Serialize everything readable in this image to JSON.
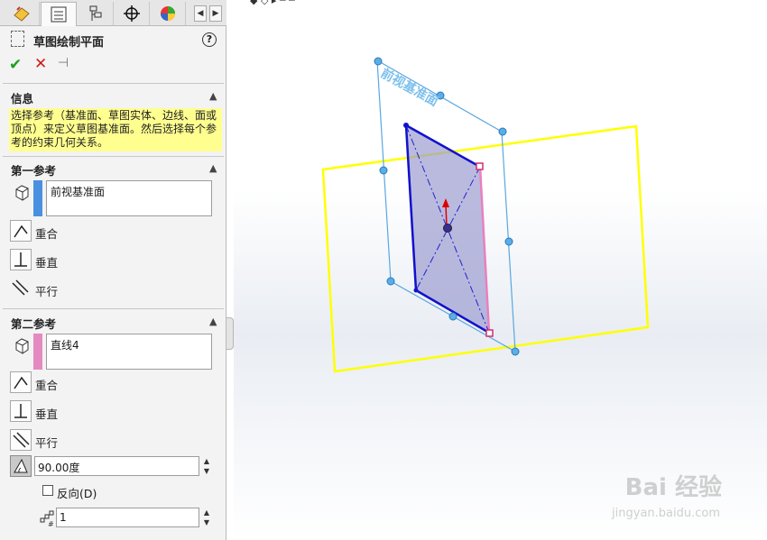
{
  "property_manager": {
    "title": "草图绘制平面",
    "help_symbol": "?",
    "actions": {
      "ok": "✔",
      "cancel": "✕",
      "pin": "⊣"
    },
    "info": {
      "header": "信息",
      "message": "选择参考（基准面、草图实体、边线、面或顶点）来定义草图基准面。然后选择每个参考的约束几何关系。"
    },
    "first_reference": {
      "header": "第一参考",
      "value": "前视基准面",
      "color": "#4a90e0",
      "relations": [
        "重合",
        "垂直",
        "平行"
      ]
    },
    "second_reference": {
      "header": "第二参考",
      "value": "直线4",
      "color": "#e48ac0",
      "relations": [
        "重合",
        "垂直",
        "平行"
      ],
      "angle": "90.00度",
      "flip_label": "反向(D)",
      "count": "1"
    }
  },
  "viewport": {
    "doc_title": "◆ ◇ ▸ ─ ─",
    "plane_label": "前视基准面",
    "watermark": "Bai 经验",
    "watermark_url": "jingyan.baidu.com"
  },
  "icons": [
    "feature-manager-icon",
    "property-manager-icon",
    "configuration-icon",
    "dimxpert-icon",
    "appearance-icon",
    "sketch-plane-icon",
    "help-icon",
    "ok-icon",
    "cancel-icon",
    "pin-icon",
    "reference-icon",
    "coincident-icon",
    "perpendicular-icon",
    "parallel-icon",
    "angle-icon",
    "count-icon"
  ]
}
